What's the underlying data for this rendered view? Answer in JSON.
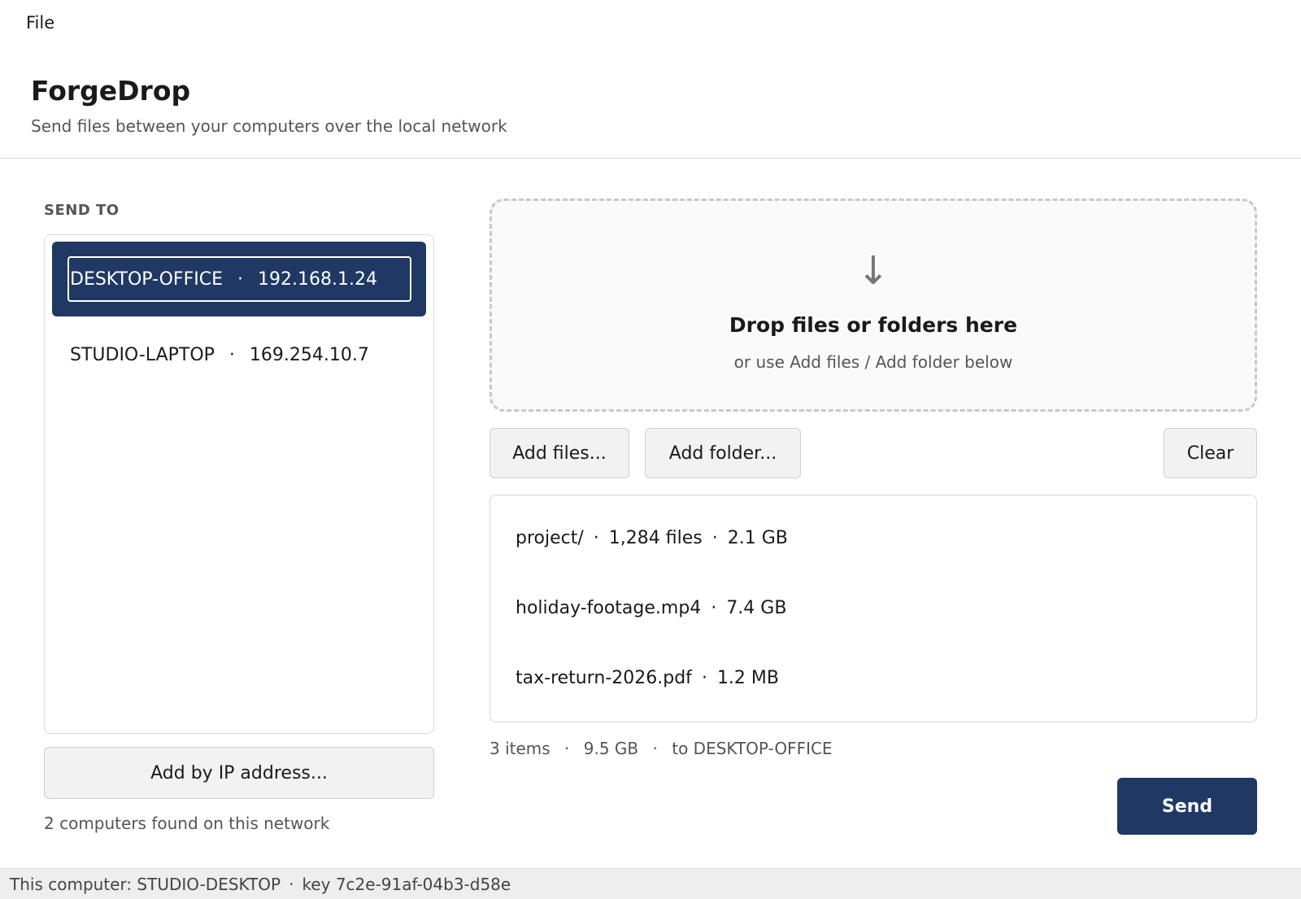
{
  "menu": {
    "file_label": "File"
  },
  "header": {
    "title": "ForgeDrop",
    "subtitle": "Send files between your computers over the local network"
  },
  "send_to": {
    "label": "SEND TO",
    "devices": [
      {
        "name": "DESKTOP-OFFICE",
        "ip": "192.168.1.24",
        "selected": true
      },
      {
        "name": "STUDIO-LAPTOP",
        "ip": "169.254.10.7",
        "selected": false
      }
    ],
    "separator": "·",
    "add_ip_label": "Add by IP address...",
    "found_text": "2 computers found on this network"
  },
  "dropzone": {
    "arrow_glyph": "↓",
    "title": "Drop files or folders here",
    "subtitle": "or use Add files / Add folder below"
  },
  "actions": {
    "add_files_label": "Add files...",
    "add_folder_label": "Add folder...",
    "clear_label": "Clear"
  },
  "files": [
    {
      "name": "project/",
      "count": "1,284 files",
      "size": "2.1 GB"
    },
    {
      "name": "holiday-footage.mp4",
      "size": "7.4 GB"
    },
    {
      "name": "tax-return-2026.pdf",
      "size": "1.2 MB"
    }
  ],
  "summary": {
    "items": "3 items",
    "total_size": "9.5 GB",
    "target": "to DESKTOP-OFFICE"
  },
  "send_label": "Send",
  "status": {
    "this_computer": "This computer: STUDIO-DESKTOP",
    "key": "key 7c2e-91af-04b3-d58e"
  },
  "colors": {
    "accent": "#1f3864",
    "button_bg": "#f2f2f2",
    "status_bg": "#eeeeee"
  }
}
